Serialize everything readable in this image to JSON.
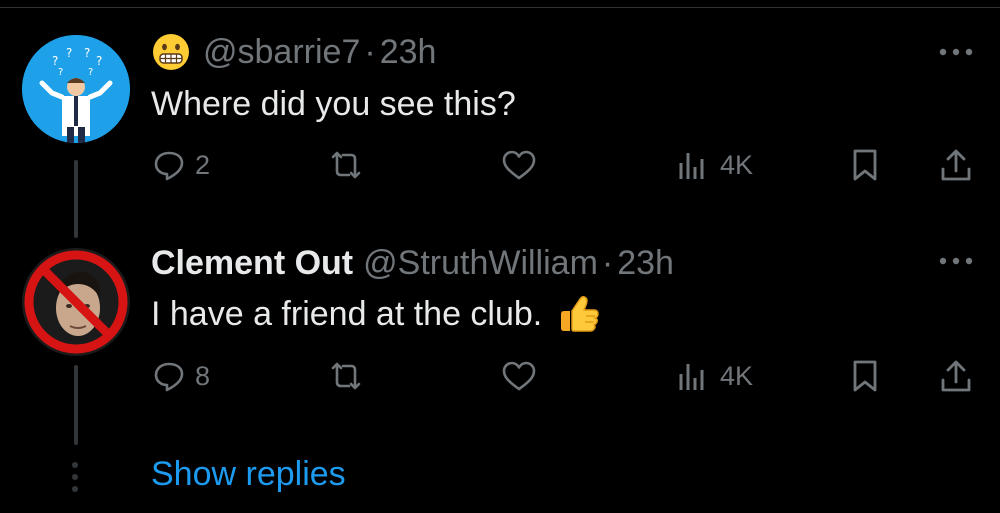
{
  "colors": {
    "background": "#000000",
    "text": "#e7e9ea",
    "muted": "#71767b",
    "link": "#1d9bf0",
    "avatar_blue": "#1ea1e8"
  },
  "tweets": [
    {
      "display_name": "",
      "display_emoji": "grimacing-face-emoji",
      "handle": "@sbarrie7",
      "time": "23h",
      "text": "Where did you see this?",
      "text_emoji": "",
      "actions": {
        "replies": "2",
        "reposts": "",
        "likes": "",
        "views": "4K"
      }
    },
    {
      "display_name": "Clement Out",
      "handle": "@StruthWilliam",
      "time": "23h",
      "text": "I have a friend at the club.",
      "text_emoji": "thumbs-up-emoji",
      "actions": {
        "replies": "8",
        "reposts": "",
        "likes": "",
        "views": "4K"
      }
    }
  ],
  "show_replies_label": "Show replies",
  "separator": "·"
}
